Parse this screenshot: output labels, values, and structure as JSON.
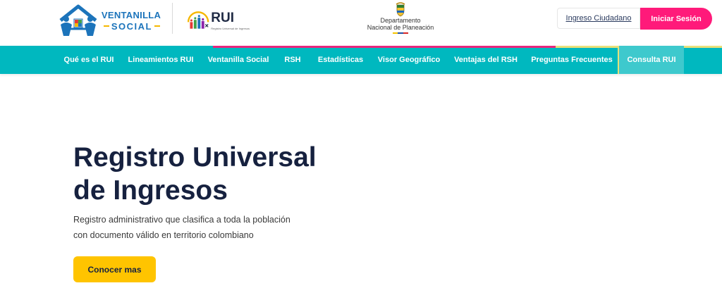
{
  "header": {
    "ventanilla_logo": {
      "line1": "VENTANILLA",
      "line2": "SOCIAL"
    },
    "rui_logo": {
      "word": "RUI",
      "subtitle": "Registro Universal de Ingresos"
    },
    "dnp_logo": {
      "line1": "Departamento",
      "line2": "Nacional de Planeación"
    },
    "ingreso_label": "Ingreso Ciudadano",
    "iniciar_label": "Iniciar Sesión"
  },
  "nav": {
    "items": [
      {
        "label": "Qué es el RUI"
      },
      {
        "label": "Lineamientos RUI"
      },
      {
        "label": "Ventanilla Social"
      },
      {
        "label": "RSH"
      },
      {
        "label": "Estadísticas"
      },
      {
        "label": "Visor Geográfico"
      },
      {
        "label": "Ventajas del RSH"
      },
      {
        "label": "Preguntas Frecuentes"
      },
      {
        "label": "Consulta RUI"
      }
    ],
    "active": "Consulta RUI"
  },
  "hero": {
    "title_line1": "Registro Universal",
    "title_line2": "de Ingresos",
    "desc_line1": "Registro administrativo que clasifica a toda la población",
    "desc_line2": "con documento válido en territorio colombiano",
    "button_label": "Conocer mas"
  },
  "colors": {
    "nav_bg": "#00b8bf",
    "brand_pink": "#ff1a7a",
    "button_yellow": "#ffc400",
    "title_navy": "#16213f",
    "logo_blue": "#1c74bb"
  }
}
